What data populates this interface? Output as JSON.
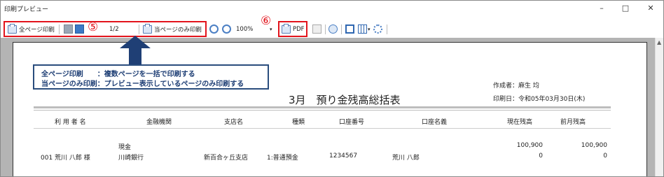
{
  "window": {
    "title": "印刷プレビュー",
    "minimize": "–",
    "maximize": "□",
    "close": "✕"
  },
  "toolbar": {
    "print_all": "全ページ印刷",
    "marker5": "⑤",
    "page": "1/2",
    "print_current": "当ページのみ印刷",
    "zoom": "100%",
    "marker6": "⑥",
    "pdf": "PDF"
  },
  "callout": {
    "line1": "全ページ印刷　　：複数ページを一括で印刷する",
    "line2": "当ページのみ印刷：プレビュー表示しているページのみ印刷する"
  },
  "report": {
    "title_suffix": "3月　預り金残高総括表",
    "author": "作成者：麻生 均",
    "print_date": "印刷日：令和05年03月30日(木)",
    "headers": [
      "利 用 者 名",
      "金融機関",
      "支店名",
      "種類",
      "口座番号",
      "口座名義",
      "現在残高",
      "前月残高"
    ],
    "row": {
      "user": "001 荒川 八郎 様",
      "institution_type": "現金",
      "institution": "川崎銀行",
      "branch": "新百合ヶ丘支店",
      "kind": "1:普通預金",
      "account_no": "1234567",
      "holder": "荒川 八郎",
      "current_1": "100,900",
      "current_2": "0",
      "prev_1": "100,900",
      "prev_2": "0"
    }
  },
  "colors": {
    "highlight": "#e2141c",
    "callout": "#2a4d7d",
    "arrow": "#1f3f75"
  },
  "icons": [
    "printer-icon",
    "first-page-icon",
    "prev-page-icon",
    "zoom-in-icon",
    "zoom-out-icon",
    "dropdown-icon",
    "copy-icon",
    "search-icon",
    "single-page-icon",
    "multi-page-icon",
    "settings-icon"
  ]
}
